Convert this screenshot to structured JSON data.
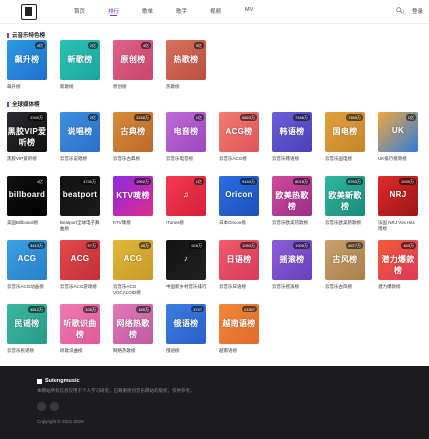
{
  "header": {
    "nav": [
      {
        "label": "首页"
      },
      {
        "label": "排行"
      },
      {
        "label": "歌单"
      },
      {
        "label": "歌手"
      },
      {
        "label": "视频"
      },
      {
        "label": "MV"
      }
    ],
    "login_label": "登录",
    "accent_color": "#6b3fd1"
  },
  "section1": {
    "title": "云音乐特色榜",
    "cards": [
      {
        "cover_text": "飙升榜",
        "badge": "4亿",
        "name": "飙升榜",
        "color1": "#2b9be0",
        "color2": "#1f6fd0"
      },
      {
        "cover_text": "新歌榜",
        "badge": "2亿",
        "name": "新歌榜",
        "color1": "#2cc3b3",
        "color2": "#1aa5a0"
      },
      {
        "cover_text": "原创榜",
        "badge": "4亿",
        "name": "原创榜",
        "color1": "#e0608a",
        "color2": "#c8466e"
      },
      {
        "cover_text": "热歌榜",
        "badge": "9亿",
        "name": "热歌榜",
        "color1": "#d9705c",
        "color2": "#b9503f"
      }
    ]
  },
  "section2": {
    "title": "全球媒体榜",
    "cards": [
      {
        "cover_text": "黑胶VIP爱听榜",
        "badge": "2340万",
        "name": "黑胶VIP爱听榜",
        "color1": "#2a2a2e",
        "color2": "#111111"
      },
      {
        "cover_text": "说唱榜",
        "badge": "2亿",
        "name": "云音乐说唱榜",
        "color1": "#3f8fe0",
        "color2": "#2a6fc9"
      },
      {
        "cover_text": "古典榜",
        "badge": "3248万",
        "name": "云音乐古典榜",
        "color1": "#d88a3c",
        "color2": "#b96a28"
      },
      {
        "cover_text": "电音榜",
        "badge": "1亿",
        "name": "云音乐电音榜",
        "color1": "#c06ad8",
        "color2": "#9a48bd"
      },
      {
        "cover_text": "ACG榜",
        "badge": "6823万",
        "name": "云音乐ACG榜",
        "color1": "#f07e6e",
        "color2": "#e0525b"
      },
      {
        "cover_text": "韩语榜",
        "badge": "7166万",
        "name": "云音乐韩语榜",
        "color1": "#6a5fd6",
        "color2": "#4b3fb8"
      },
      {
        "cover_text": "国电榜",
        "badge": "7465万",
        "name": "云音乐国电榜",
        "color1": "#e0a23c",
        "color2": "#c7842a"
      },
      {
        "cover_text": "UK",
        "badge": "1亿",
        "name": "UK排行榜周榜",
        "color1": "#f0a83a",
        "color2": "#2f7be0"
      },
      {
        "cover_text": "billboard",
        "badge": "4亿",
        "name": "美国Billboard榜",
        "color1": "#111111",
        "color2": "#000000"
      },
      {
        "cover_text": "beatport",
        "badge": "4730万",
        "name": "Beatport全球电子舞曲榜",
        "color1": "#111111",
        "color2": "#1b1b1b"
      },
      {
        "cover_text": "KTV唛榜",
        "badge": "1992万",
        "name": "KTV唛榜",
        "color1": "#8a2be2",
        "color2": "#e02b8a"
      },
      {
        "cover_text": "♫",
        "badge": "1亿",
        "name": "iTunes榜",
        "color1": "#f2394f",
        "color2": "#d6203a"
      },
      {
        "cover_text": "Oricon",
        "badge": "5144万",
        "name": "日本Oricon榜",
        "color1": "#2a6fe0",
        "color2": "#1d4fb8"
      },
      {
        "cover_text": "欧美热歌榜",
        "badge": "8018万",
        "name": "云音乐欧美热歌榜",
        "color1": "#d04a9a",
        "color2": "#9a2f8a"
      },
      {
        "cover_text": "欧美新歌榜",
        "badge": "6763万",
        "name": "云音乐欧美新歌榜",
        "color1": "#2fb8a0",
        "color2": "#1a8a7a"
      },
      {
        "cover_text": "NRJ",
        "badge": "2639万",
        "name": "法国 NRJ Vos Hits 周榜",
        "color1": "#e02b2b",
        "color2": "#9a1515"
      },
      {
        "cover_text": "ACG",
        "badge": "3413万",
        "name": "云音乐ACG动画榜",
        "color1": "#3aa0e0",
        "color2": "#2a7fc9"
      },
      {
        "cover_text": "ACG",
        "badge": "97万",
        "name": "云音乐ACG游戏榜",
        "color1": "#e04a4a",
        "color2": "#c32f3a"
      },
      {
        "cover_text": "ACG",
        "badge": "48万",
        "name": "云音乐ACG VOCALOID榜",
        "color1": "#e0b83a",
        "color2": "#c79a28"
      },
      {
        "cover_text": "♪",
        "badge": "526万",
        "name": "中国新乡村音乐排行榜",
        "color1": "#111111",
        "color2": "#222222"
      },
      {
        "cover_text": "日语榜",
        "badge": "1093万",
        "name": "云音乐日语榜",
        "color1": "#f05a6a",
        "color2": "#d83a5a"
      },
      {
        "cover_text": "摇滚榜",
        "badge": "1926万",
        "name": "云音乐摇滚榜",
        "color1": "#8a5fd6",
        "color2": "#6a3fbd"
      },
      {
        "cover_text": "古风榜",
        "badge": "4877万",
        "name": "云音乐古风榜",
        "color1": "#c8a06a",
        "color2": "#a8804a"
      },
      {
        "cover_text": "潜力爆款榜",
        "badge": "463万",
        "name": "潜力爆款榜",
        "color1": "#f05a3a",
        "color2": "#e03a5a"
      },
      {
        "cover_text": "民谣榜",
        "badge": "4812万",
        "name": "云音乐民谣榜",
        "color1": "#3ab8a0",
        "color2": "#2a9a8a"
      },
      {
        "cover_text": "听歌识曲榜",
        "badge": "106万",
        "name": "听歌识曲榜",
        "color1": "#f07ab0",
        "color2": "#e05a9a"
      },
      {
        "cover_text": "网络热歌榜",
        "badge": "169万",
        "name": "网络热歌榜",
        "color1": "#e07ab8",
        "color2": "#c05aa0"
      },
      {
        "cover_text": "俄语榜",
        "badge": "3747",
        "name": "俄语榜",
        "color1": "#3a7fe0",
        "color2": "#2a5fc9"
      },
      {
        "cover_text": "越南语榜",
        "badge": "43367",
        "name": "越南语榜",
        "color1": "#f08a3a",
        "color2": "#e06a2a"
      }
    ]
  },
  "footer": {
    "brand": "Sutengmusic",
    "desc": "本网站所有信息仅用于个人学习研究，已尊重原创音乐网站的版权，仅供参考。",
    "copyright": "Copyright © 2021-2029"
  }
}
